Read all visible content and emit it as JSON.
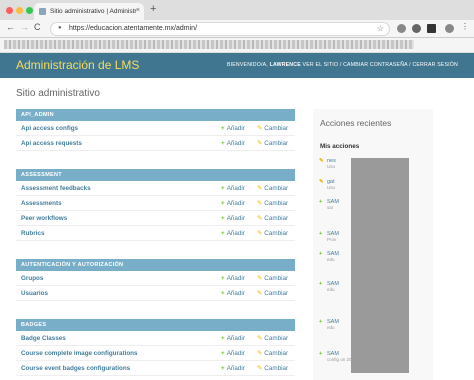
{
  "browser": {
    "tab_title": "Sitio administrativo | Administr",
    "tab_close": "×",
    "newtab": "+",
    "back": "←",
    "forward": "→",
    "reload": "C",
    "url": "https://educacion.atentamente.mx/admin/",
    "star": "☆"
  },
  "header": {
    "brand": "Administración de LMS",
    "welcome": "BIENVENIDO/A,",
    "user": "LAWRENCE",
    "links": " VER EL SITIO / CAMBIAR CONTRASEÑA / CERRAR SESIÓN"
  },
  "page_title": "Sitio administrativo",
  "add_label": "Añadir",
  "change_label": "Cambiar",
  "modules": [
    {
      "caption": "API_ADMIN",
      "rows": [
        "Api access configs",
        "Api access requests"
      ]
    },
    {
      "caption": "ASSESSMENT",
      "rows": [
        "Assessment feedbacks",
        "Assessments",
        "Peer workflows",
        "Rubrics"
      ]
    },
    {
      "caption": "AUTENTICACIÓN Y AUTORIZACIÓN",
      "rows": [
        "Grupos",
        "Usuarios"
      ]
    },
    {
      "caption": "BADGES",
      "rows": [
        "Badge Classes",
        "Course complete image configurations",
        "Course event badges configurations"
      ]
    }
  ],
  "recent": {
    "title": "Acciones recientes",
    "subtitle": "Mis acciones",
    "entries": [
      {
        "icon": "pencil",
        "text": "nes",
        "sub": "Usu"
      },
      {
        "icon": "pencil",
        "text": "gat",
        "sub": "Usu"
      },
      {
        "icon": "plus",
        "text": "SAM",
        "sub": "sar"
      },
      {
        "icon": "plus",
        "text": "SAM",
        "sub": "Prov"
      },
      {
        "icon": "plus",
        "text": "SAM",
        "sub": "edu"
      },
      {
        "icon": "plus",
        "text": "SAM",
        "sub": "edu"
      },
      {
        "icon": "plus",
        "text": "SAM",
        "sub": "edu"
      },
      {
        "icon": "plus",
        "text": "SAM",
        "sub": "config on 2018-06-15 00:31:11"
      }
    ]
  }
}
